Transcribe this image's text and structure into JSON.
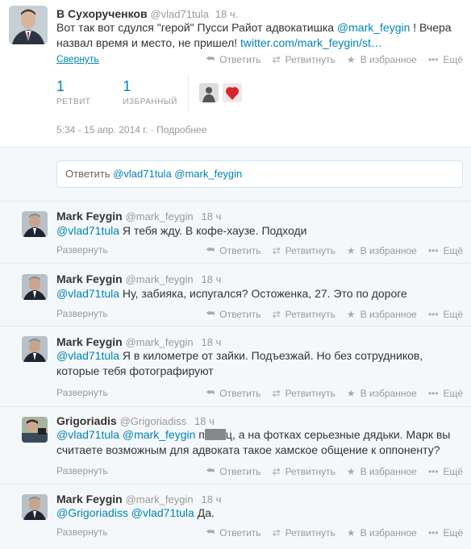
{
  "main": {
    "name": "В Сухорученков",
    "handle": "@vlad71tula",
    "time": "18 ч.",
    "text_a": "Вот так вот сдулся \"герой\" Пусси Райот адвокатишка ",
    "mention": "@mark_feygin",
    "text_b": " ! Вчера назвал время и место, не пришел! ",
    "url": "twitter.com/mark_feygin/st…",
    "collapse": "Свернуть",
    "retweets_count": "1",
    "retweets_label": "РЕТВИТ",
    "favorites_count": "1",
    "favorites_label": "ИЗБРАННЫЙ",
    "timestamp": "5:34 - 15 апр. 2014 г. ·",
    "details": "Подробнее"
  },
  "actions": {
    "reply": "Ответить",
    "retweet": "Ретвитнуть",
    "favorite": "В избранное",
    "more": "Ещё"
  },
  "reply_box": {
    "prefix": "Ответить",
    "mentions": "@vlad71tula @mark_feygin"
  },
  "expand_label": "Развернуть",
  "tweets": [
    {
      "name": "Mark Feygin",
      "handle": "@mark_feygin",
      "time": "18 ч",
      "mention": "@vlad71tula",
      "text": " Я тебя жду. В кофе-хаузе. Подходи"
    },
    {
      "name": "Mark Feygin",
      "handle": "@mark_feygin",
      "time": "18 ч",
      "mention": "@vlad71tula",
      "text": " Ну, забияка, испугался? Остоженка, 27. Это по дороге"
    },
    {
      "name": "Mark Feygin",
      "handle": "@mark_feygin",
      "time": "18 ч",
      "mention": "@vlad71tula",
      "text": " Я в километре от зайки. Подъезжай. Но без сотрудников, которые тебя фотографируют"
    },
    {
      "name": "Grigoriadis",
      "handle": "@Grigoriadiss",
      "time": "18 ч",
      "mention": "@vlad71tula @mark_feygin",
      "text_pre": " п",
      "text": "ц, а на фотках серьезные дядьки. Марк вы считаете возможным для адвоката такое хамское общение к оппоненту?"
    },
    {
      "name": "Mark Feygin",
      "handle": "@mark_feygin",
      "time": "18 ч",
      "mention": "@Grigoriadiss @vlad71tula",
      "text": " Да."
    }
  ],
  "icons": {
    "reply": "reply-icon",
    "retweet": "retweet-icon",
    "favorite": "star-icon",
    "more": "more-icon"
  }
}
